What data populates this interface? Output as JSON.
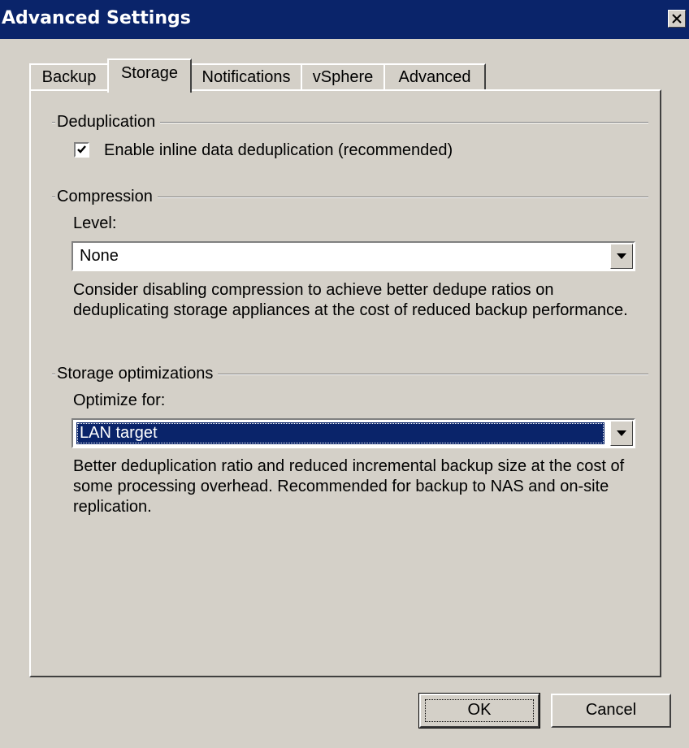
{
  "window": {
    "title": "Advanced Settings",
    "close_icon": "close-icon"
  },
  "tabs": [
    {
      "label": "Backup",
      "active": false
    },
    {
      "label": "Storage",
      "active": true
    },
    {
      "label": "Notifications",
      "active": false
    },
    {
      "label": "vSphere",
      "active": false
    },
    {
      "label": "Advanced",
      "active": false
    }
  ],
  "deduplication": {
    "group_label": "Deduplication",
    "checkbox_label": "Enable inline data deduplication (recommended)",
    "checked": true
  },
  "compression": {
    "group_label": "Compression",
    "level_label": "Level:",
    "level_value": "None",
    "description": "Consider disabling compression to achieve better dedupe ratios on deduplicating storage appliances at the cost of reduced backup performance."
  },
  "storage_optimizations": {
    "group_label": "Storage optimizations",
    "optimize_label": "Optimize for:",
    "optimize_value": "LAN target",
    "description": "Better deduplication ratio and reduced incremental backup size at the cost of some processing overhead. Recommended for backup to NAS and on-site replication."
  },
  "buttons": {
    "ok_label": "OK",
    "cancel_label": "Cancel"
  },
  "colors": {
    "titlebar": "#0a246a",
    "face": "#d4d0c8",
    "selection": "#0a246a"
  }
}
